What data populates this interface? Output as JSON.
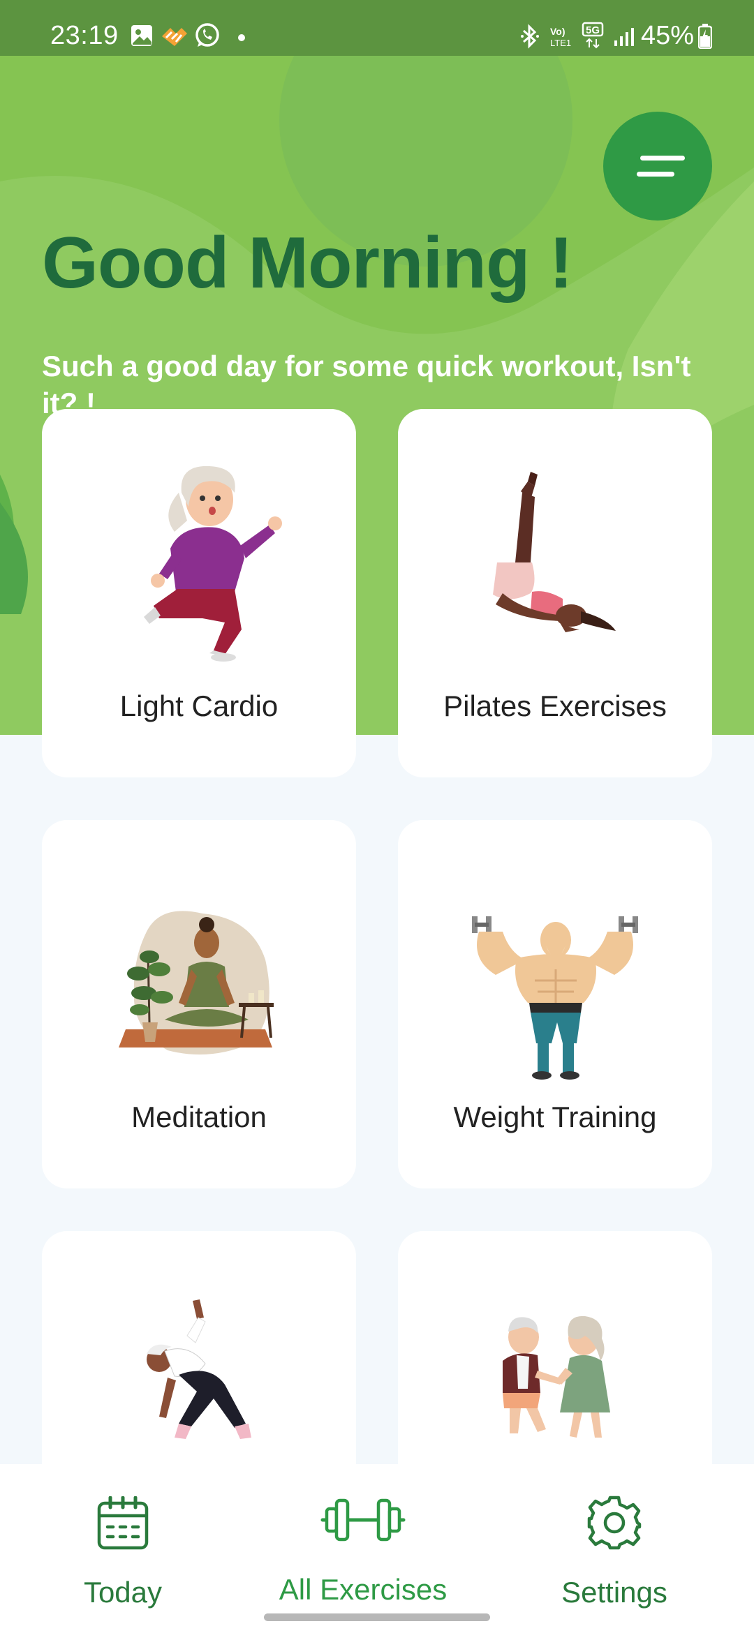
{
  "status_bar": {
    "time": "23:19",
    "battery": "45%",
    "network": "5G",
    "icons": [
      "gallery-icon",
      "health-app-icon",
      "whatsapp-icon",
      "notification-dot-icon",
      "bluetooth-icon",
      "volte-icon",
      "5g-icon",
      "signal-icon",
      "battery-icon"
    ]
  },
  "header": {
    "greeting": "Good Morning !",
    "subtitle": "Such a good day for some quick workout, Isn't it? !",
    "menu_icon": "menu-icon"
  },
  "exercises": [
    {
      "label": "Light Cardio",
      "icon": "light-cardio-illustration"
    },
    {
      "label": "Pilates Exercises",
      "icon": "pilates-illustration"
    },
    {
      "label": "Meditation",
      "icon": "meditation-illustration"
    },
    {
      "label": "Weight Training",
      "icon": "weight-training-illustration"
    },
    {
      "label": "",
      "icon": "stretching-illustration"
    },
    {
      "label": "",
      "icon": "dancing-illustration"
    }
  ],
  "bottom_nav": {
    "items": [
      {
        "label": "Today",
        "icon": "calendar-icon"
      },
      {
        "label": "All Exercises",
        "icon": "dumbbell-icon"
      },
      {
        "label": "Settings",
        "icon": "gear-icon"
      }
    ],
    "active": "All Exercises"
  },
  "colors": {
    "header_green": "#85c452",
    "status_green": "#5c9440",
    "greeting_text": "#1f6b3c",
    "menu_button": "#2f9a45",
    "nav_text": "#2a7a3c",
    "page_bg": "#f3f8fc"
  }
}
